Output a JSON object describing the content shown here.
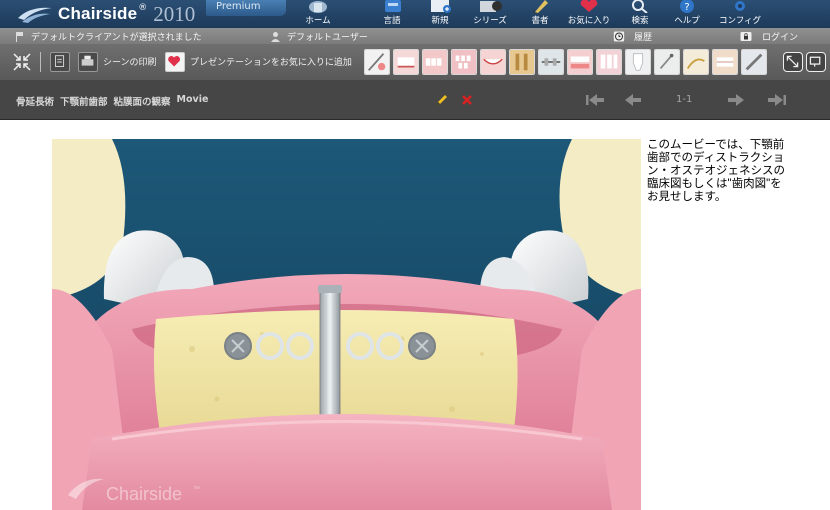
{
  "header": {
    "app_name": "Chairside",
    "app_mark": "®",
    "version_year": "2010",
    "edition": "Premium",
    "nav": [
      {
        "label": "ホーム",
        "icon": "home-icon"
      },
      {
        "label": "言語",
        "icon": "language-icon"
      },
      {
        "label": "新規",
        "icon": "new-icon"
      },
      {
        "label": "シリーズ",
        "icon": "series-icon"
      },
      {
        "label": "書者",
        "icon": "author-icon"
      },
      {
        "label": "お気に入り",
        "icon": "favorites-icon"
      },
      {
        "label": "検索",
        "icon": "search-icon"
      },
      {
        "label": "ヘルプ",
        "icon": "help-icon"
      },
      {
        "label": "コンフィグ",
        "icon": "config-icon"
      }
    ]
  },
  "status": {
    "client": "デフォルトクライアントが選択されました",
    "user": "デフォルトユーザー",
    "history": "履歴",
    "login": "ログイン"
  },
  "toolbar": {
    "print_label": "シーンの印刷",
    "favorite_label": "プレゼンテーションをお気に入りに追加"
  },
  "breadcrumb": [
    "骨延長術",
    "下顎前歯部",
    "粘膜面の観察",
    "Movie"
  ],
  "pager": {
    "text": "1-1"
  },
  "content": {
    "description": "このムービーでは、下顎前歯部でのディストラクション・オステオジェネシスの臨床図もしくは\"歯肉図\"をお見せします。",
    "watermark": "Chairside",
    "watermark_mark": "™"
  },
  "colors": {
    "header": "#1d3a5a",
    "toolbar": "#5f5f5f",
    "crumb_bar": "#464646",
    "pencil": "#f0c020",
    "delete": "#e02020"
  }
}
